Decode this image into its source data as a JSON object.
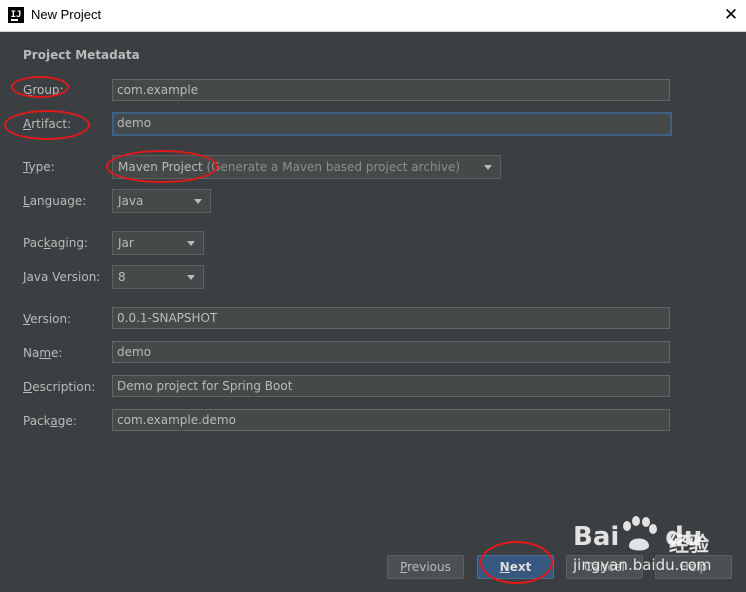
{
  "window": {
    "title": "New Project",
    "close_glyph": "✕",
    "icon_glyph": "IJ"
  },
  "section_title": "Project Metadata",
  "fields": {
    "group": {
      "label_m": "G",
      "label_rest": "roup:",
      "value": "com.example"
    },
    "artifact": {
      "label_m": "A",
      "label_rest": "rtifact:",
      "value": "demo"
    },
    "type": {
      "label_m": "T",
      "label_rest": "ype:",
      "value": "Maven Project",
      "hint": "(Generate a Maven based project archive)"
    },
    "language": {
      "label_m": "L",
      "label_rest": "anguage:",
      "value": "Java"
    },
    "packaging": {
      "label_pre": "Pac",
      "label_m": "k",
      "label_rest": "aging:",
      "value": "Jar"
    },
    "java_version": {
      "label_m": "J",
      "label_rest": "ava Version:",
      "value": "8"
    },
    "version": {
      "label_m": "V",
      "label_rest": "ersion:",
      "value": "0.0.1-SNAPSHOT"
    },
    "name": {
      "label_pre": "Na",
      "label_m": "m",
      "label_rest": "e:",
      "value": "demo"
    },
    "description": {
      "label_m": "D",
      "label_rest": "escription:",
      "value": "Demo project for Spring Boot"
    },
    "package": {
      "label_pre": "Pack",
      "label_m": "a",
      "label_rest": "ge:",
      "value": "com.example.demo"
    }
  },
  "buttons": {
    "previous": {
      "m": "P",
      "rest": "revious"
    },
    "next": {
      "m": "N",
      "rest": "ext"
    },
    "cancel": {
      "label": "Cancel"
    },
    "help": {
      "label": "Help"
    }
  },
  "watermark": {
    "logo": "Bai",
    "logo_du": "du",
    "cn": "经验",
    "url": "jingyan.baidu.com"
  },
  "colors": {
    "background": "#3c3f41",
    "field_bg": "#45494a",
    "text": "#bbbbbb",
    "focus_border": "#3d6185",
    "default_button": "#365880",
    "annotation_red": "#e0191a"
  }
}
